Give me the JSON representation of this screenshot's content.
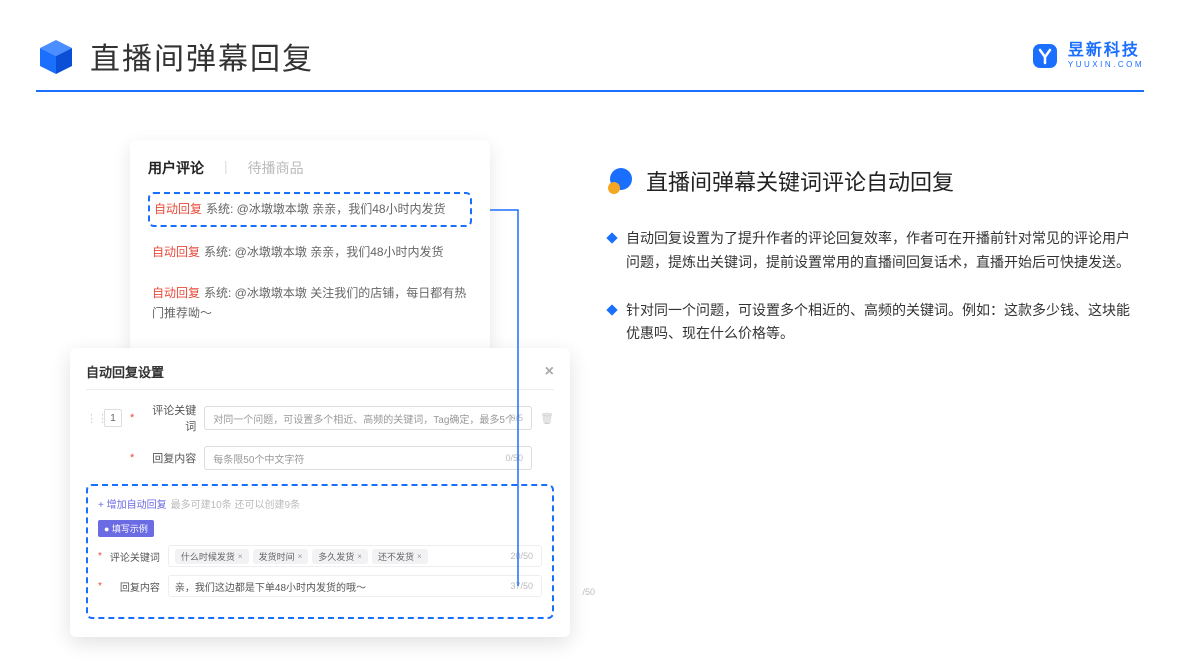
{
  "header": {
    "title": "直播间弹幕回复",
    "logo_cn": "昱新科技",
    "logo_en": "YUUXIN.COM"
  },
  "comments": {
    "tab_active": "用户评论",
    "tab_inactive": "待播商品",
    "items": [
      {
        "badge": "自动回复",
        "text": "系统: @冰墩墩本墩 亲亲，我们48小时内发货"
      },
      {
        "badge": "自动回复",
        "text": "系统: @冰墩墩本墩 亲亲，我们48小时内发货"
      },
      {
        "badge": "自动回复",
        "text": "系统: @冰墩墩本墩 关注我们的店铺，每日都有热门推荐呦～"
      }
    ]
  },
  "settings": {
    "title": "自动回复设置",
    "row_num": "1",
    "keyword_label": "评论关键词",
    "keyword_placeholder": "对同一个问题，可设置多个相近、高频的关键词，Tag确定，最多5个",
    "keyword_counter": "0/5",
    "reply_label": "回复内容",
    "reply_placeholder": "每条限50个中文字符",
    "reply_counter": "0/50",
    "add_link": "+ 增加自动回复",
    "add_hint": "最多可建10条 还可以创建9条",
    "ex_badge": "● 填写示例",
    "ex_keyword_label": "评论关键词",
    "ex_tags": [
      "什么时候发货",
      "发货时间",
      "多久发货",
      "还不发货"
    ],
    "ex_keyword_counter": "20/50",
    "ex_reply_label": "回复内容",
    "ex_reply_text": "亲，我们这边都是下单48小时内发货的哦～",
    "ex_reply_counter": "37/50",
    "partial_counter": "/50"
  },
  "right": {
    "section_title": "直播间弹幕关键词评论自动回复",
    "bullets": [
      "自动回复设置为了提升作者的评论回复效率，作者可在开播前针对常见的评论用户问题，提炼出关键词，提前设置常用的直播间回复话术，直播开始后可快捷发送。",
      "针对同一个问题，可设置多个相近的、高频的关键词。例如：这款多少钱、这块能优惠吗、现在什么价格等。"
    ]
  }
}
